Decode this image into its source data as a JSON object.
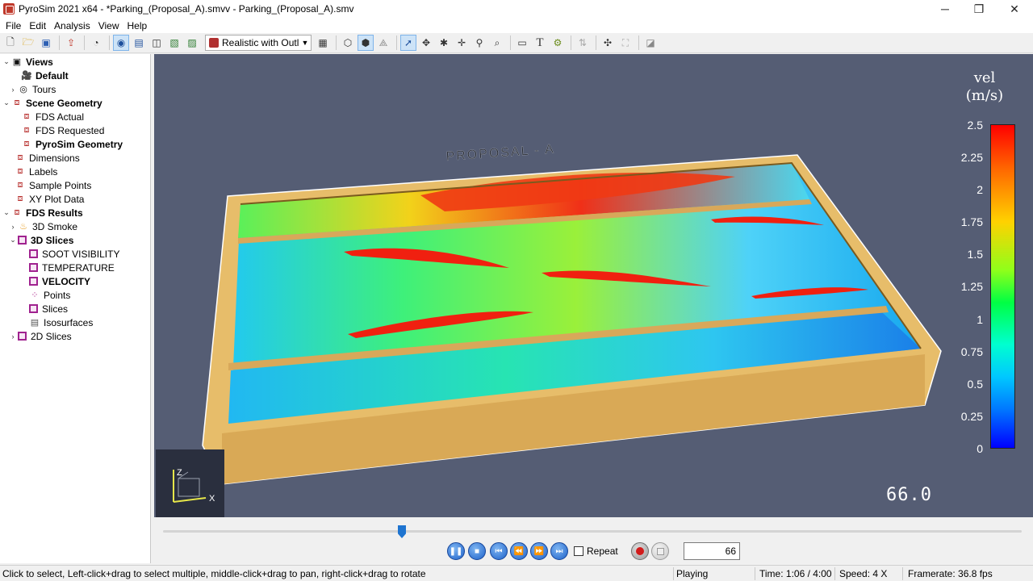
{
  "window": {
    "title": "PyroSim 2021 x64 - *Parking_(Proposal_A).smvv - Parking_(Proposal_A).smv",
    "minimize": "─",
    "restore": "❐",
    "close": "✕"
  },
  "menu": [
    "File",
    "Edit",
    "Analysis",
    "View",
    "Help"
  ],
  "toolbar": {
    "render_mode": "Realistic with Outl"
  },
  "tree": [
    {
      "label": "Views",
      "bold": true
    },
    {
      "label": "Default",
      "bold": true
    },
    {
      "label": "Tours",
      "bold": false
    },
    {
      "label": "Scene Geometry",
      "bold": true
    },
    {
      "label": "FDS Actual",
      "bold": false
    },
    {
      "label": "FDS Requested",
      "bold": false
    },
    {
      "label": "PyroSim Geometry",
      "bold": true
    },
    {
      "label": "Dimensions",
      "bold": false
    },
    {
      "label": "Labels",
      "bold": false
    },
    {
      "label": "Sample Points",
      "bold": false
    },
    {
      "label": "XY Plot Data",
      "bold": false
    },
    {
      "label": "FDS Results",
      "bold": true
    },
    {
      "label": "3D Smoke",
      "bold": false
    },
    {
      "label": "3D Slices",
      "bold": true
    },
    {
      "label": "SOOT VISIBILITY",
      "bold": false
    },
    {
      "label": "TEMPERATURE",
      "bold": false
    },
    {
      "label": "VELOCITY",
      "bold": true
    },
    {
      "label": "Points",
      "bold": false
    },
    {
      "label": "Slices",
      "bold": false
    },
    {
      "label": "Isosurfaces",
      "bold": false
    },
    {
      "label": "2D Slices",
      "bold": false
    }
  ],
  "scene": {
    "model_label": "PROPOSAL - A",
    "time_display": "66.0",
    "axis_z": "Z",
    "axis_x": "X"
  },
  "legend": {
    "title_line1": "vel",
    "title_line2": "(m/s)",
    "ticks": [
      "2.5",
      "2.25",
      "2",
      "1.75",
      "1.5",
      "1.25",
      "1",
      "0.75",
      "0.5",
      "0.25",
      "0"
    ]
  },
  "playback": {
    "repeat_label": "Repeat",
    "frame": "66",
    "progress_fraction": 0.28
  },
  "status": {
    "hint": "Click to select, Left-click+drag to select multiple, middle-click+drag to pan, right-click+drag to rotate",
    "state": "Playing",
    "time": "Time: 1:06 / 4:00",
    "speed": "Speed: 4 X",
    "framerate": "Framerate: 36.8 fps"
  },
  "colors": {
    "viewport_bg": "#555d74",
    "wall": "#e5b867",
    "accent": "#1e74d0"
  }
}
